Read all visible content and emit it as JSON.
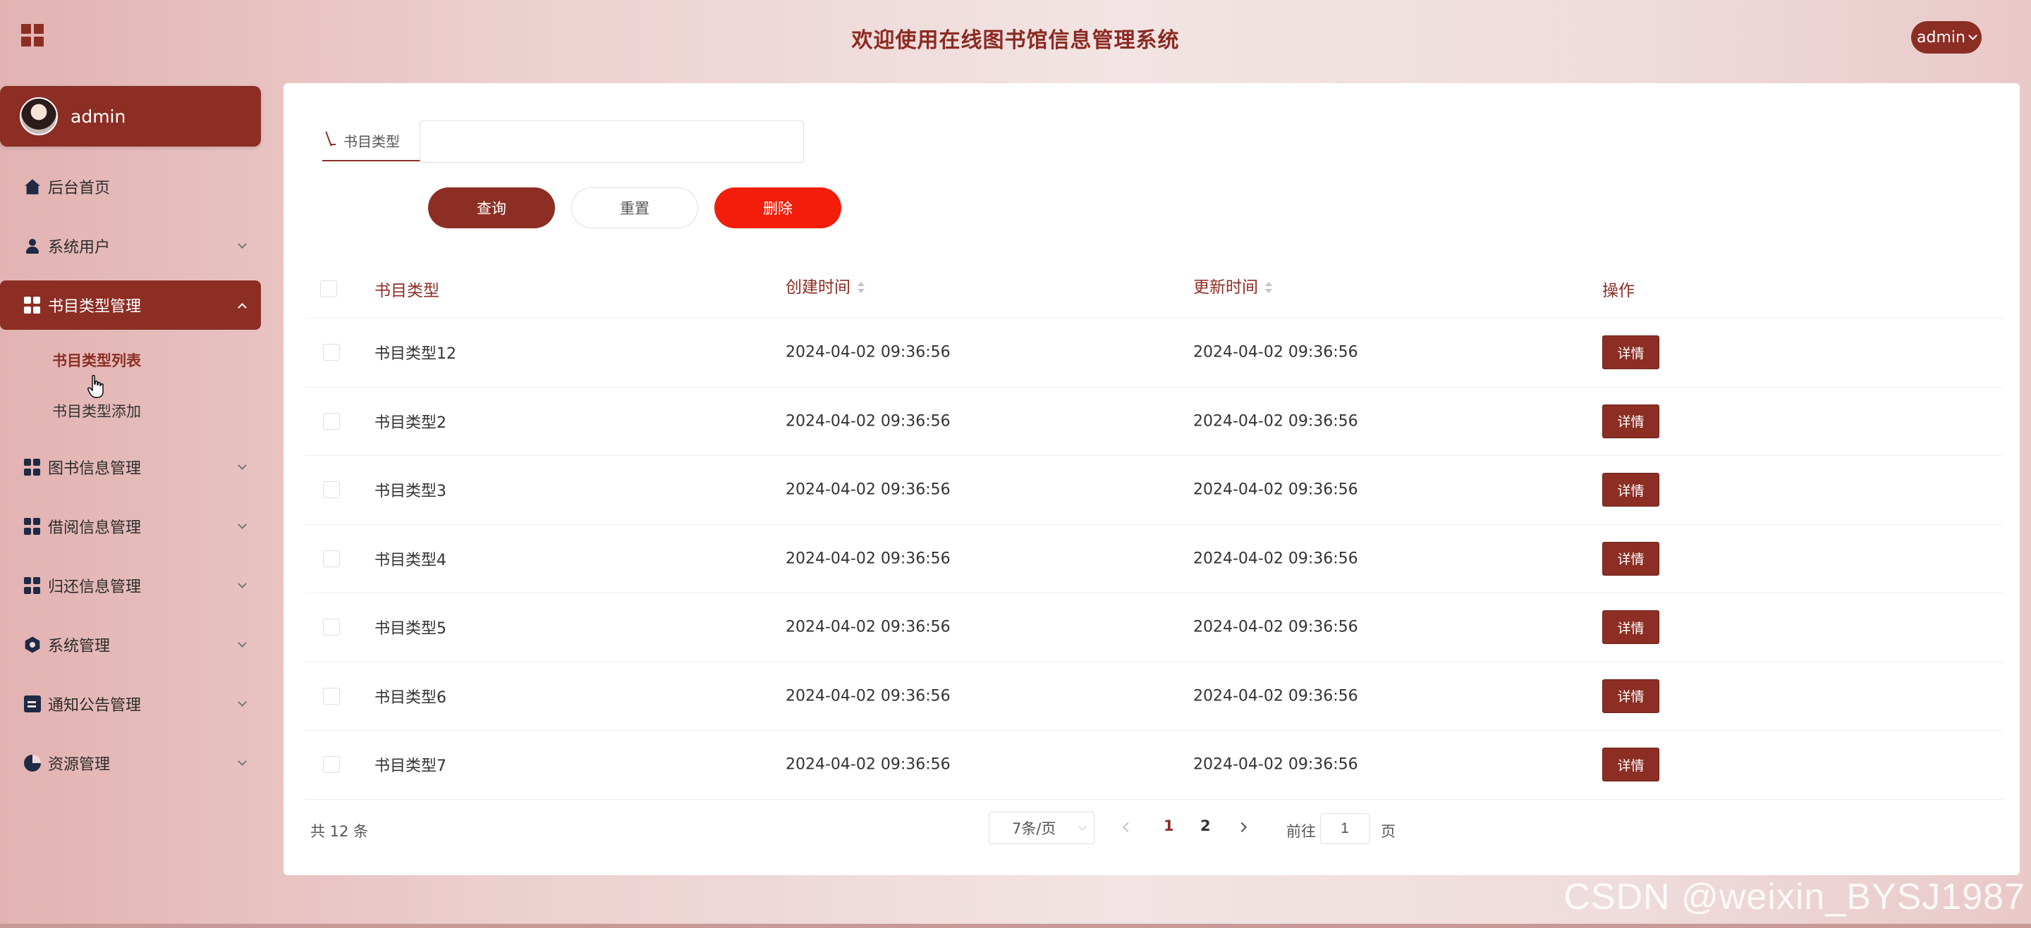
{
  "header": {
    "title": "欢迎使用在线图书馆信息管理系统",
    "user_label": "admin"
  },
  "sidebar": {
    "profile_name": "admin",
    "items": [
      {
        "label": "后台首页",
        "icon": "home-icon"
      },
      {
        "label": "系统用户",
        "icon": "user-icon"
      },
      {
        "label": "书目类型管理",
        "icon": "dashboard-icon"
      },
      {
        "label": "图书信息管理",
        "icon": "dashboard-icon"
      },
      {
        "label": "借阅信息管理",
        "icon": "dashboard-icon"
      },
      {
        "label": "归还信息管理",
        "icon": "dashboard-icon"
      },
      {
        "label": "系统管理",
        "icon": "gear-icon"
      },
      {
        "label": "通知公告管理",
        "icon": "document-icon"
      },
      {
        "label": "资源管理",
        "icon": "pie-chart-icon"
      }
    ],
    "submenu": [
      {
        "label": "书目类型列表"
      },
      {
        "label": "书目类型添加"
      }
    ]
  },
  "search": {
    "label": "书目类型",
    "value": "",
    "placeholder": ""
  },
  "buttons": {
    "query": "查询",
    "reset": "重置",
    "delete": "删除"
  },
  "table": {
    "columns": [
      "书目类型",
      "创建时间",
      "更新时间",
      "操作"
    ],
    "detail_label": "详情",
    "rows": [
      {
        "type": "书目类型12",
        "created": "2024-04-02 09:36:56",
        "updated": "2024-04-02 09:36:56"
      },
      {
        "type": "书目类型2",
        "created": "2024-04-02 09:36:56",
        "updated": "2024-04-02 09:36:56"
      },
      {
        "type": "书目类型3",
        "created": "2024-04-02 09:36:56",
        "updated": "2024-04-02 09:36:56"
      },
      {
        "type": "书目类型4",
        "created": "2024-04-02 09:36:56",
        "updated": "2024-04-02 09:36:56"
      },
      {
        "type": "书目类型5",
        "created": "2024-04-02 09:36:56",
        "updated": "2024-04-02 09:36:56"
      },
      {
        "type": "书目类型6",
        "created": "2024-04-02 09:36:56",
        "updated": "2024-04-02 09:36:56"
      },
      {
        "type": "书目类型7",
        "created": "2024-04-02 09:36:56",
        "updated": "2024-04-02 09:36:56"
      }
    ]
  },
  "pagination": {
    "total_label": "共 12 条",
    "page_size": "7条/页",
    "pages": [
      "1",
      "2"
    ],
    "current_page": "1",
    "goto_label": "前往",
    "goto_value": "1",
    "goto_suffix": "页"
  },
  "watermark": "CSDN @weixin_BYSJ1987",
  "colors": {
    "accent": "#8c2e24",
    "danger": "#f21d0a"
  }
}
